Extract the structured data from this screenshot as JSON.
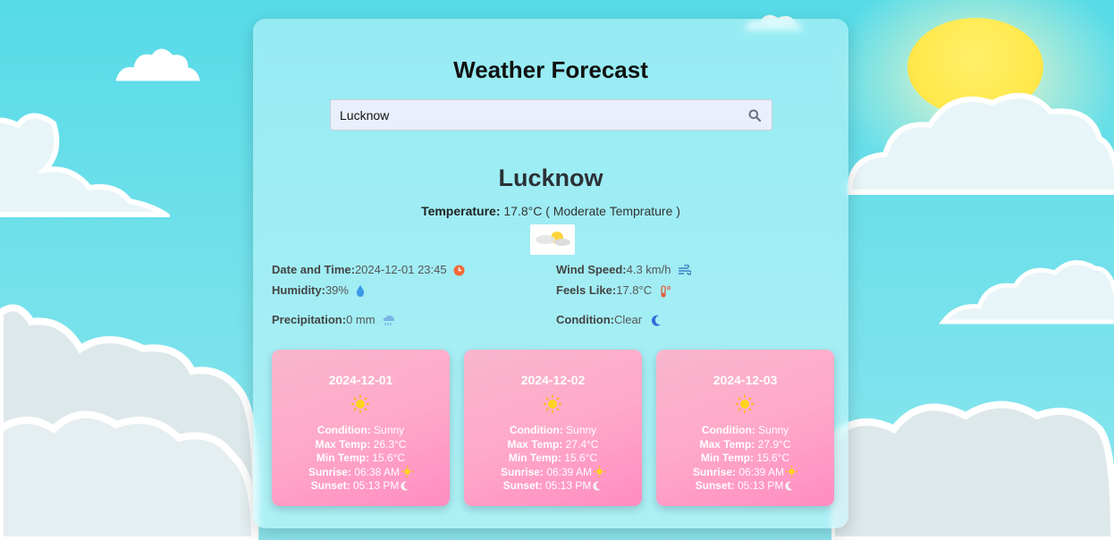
{
  "app": {
    "title": "Weather Forecast"
  },
  "search": {
    "value": "Lucknow",
    "icon": "search-icon"
  },
  "current": {
    "city": "Lucknow",
    "temperature_label": "Temperature:",
    "temperature_value": "17.8°C ( Moderate Temprature )",
    "weather_icon": "partly-cloudy-icon",
    "details": {
      "datetime_label": "Date and Time:",
      "datetime_value": "2024-12-01 23:45",
      "wind_label": "Wind Speed:",
      "wind_value": "4.3 km/h",
      "humidity_label": "Humidity:",
      "humidity_value": "39%",
      "feels_label": "Feels Like:",
      "feels_value": "17.8°C",
      "precip_label": "Precipitation:",
      "precip_value": "0 mm",
      "condition_label": "Condition:",
      "condition_value": "Clear"
    }
  },
  "forecast": [
    {
      "date": "2024-12-01",
      "condition_label": "Condition:",
      "condition": "Sunny",
      "max_label": "Max Temp:",
      "max": "26.3°C",
      "min_label": "Min Temp:",
      "min": "15.6°C",
      "sunrise_label": "Sunrise:",
      "sunrise": "06:38 AM",
      "sunset_label": "Sunset:",
      "sunset": "05:13 PM"
    },
    {
      "date": "2024-12-02",
      "condition_label": "Condition:",
      "condition": "Sunny",
      "max_label": "Max Temp:",
      "max": "27.4°C",
      "min_label": "Min Temp:",
      "min": "15.6°C",
      "sunrise_label": "Sunrise:",
      "sunrise": "06:39 AM",
      "sunset_label": "Sunset:",
      "sunset": "05:13 PM"
    },
    {
      "date": "2024-12-03",
      "condition_label": "Condition:",
      "condition": "Sunny",
      "max_label": "Max Temp:",
      "max": "27.9°C",
      "min_label": "Min Temp:",
      "min": "15.6°C",
      "sunrise_label": "Sunrise:",
      "sunrise": "06:39 AM",
      "sunset_label": "Sunset:",
      "sunset": "05:13 PM"
    }
  ],
  "colors": {
    "card_pink_start": "#f7b6cc",
    "card_pink_end": "#ff8cc0",
    "sky": "#57dbe8",
    "sun": "#ffe84a"
  }
}
